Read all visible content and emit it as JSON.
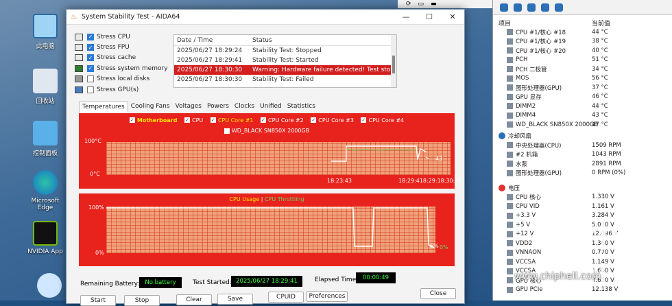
{
  "desktop": {
    "icons": [
      {
        "label": "此电脑"
      },
      {
        "label": "回收站"
      },
      {
        "label": "控制面板"
      },
      {
        "label": "Microsoft Edge"
      },
      {
        "label": "NVIDIA App"
      }
    ]
  },
  "window": {
    "title": "System Stability Test - AIDA64",
    "stress_options": [
      {
        "label": "Stress CPU",
        "checked": true
      },
      {
        "label": "Stress FPU",
        "checked": true
      },
      {
        "label": "Stress cache",
        "checked": true
      },
      {
        "label": "Stress system memory",
        "checked": true
      },
      {
        "label": "Stress local disks",
        "checked": false
      },
      {
        "label": "Stress GPU(s)",
        "checked": false
      }
    ],
    "log": {
      "col_date": "Date / Time",
      "col_status": "Status",
      "rows": [
        {
          "date": "2025/06/27 18:29:24",
          "status": "Stability Test: Stopped"
        },
        {
          "date": "2025/06/27 18:29:41",
          "status": "Stability Test: Started"
        },
        {
          "date": "2025/06/27 18:30:30",
          "status": "Warning: Hardware failure detected! Test stopp..."
        },
        {
          "date": "2025/06/27 18:30:30",
          "status": "Stability Test: Failed"
        }
      ]
    },
    "tabs": [
      "Temperatures",
      "Cooling Fans",
      "Voltages",
      "Powers",
      "Clocks",
      "Unified",
      "Statistics"
    ],
    "temp_graph": {
      "legend": [
        "Motherboard",
        "CPU",
        "CPU Core #1",
        "CPU Core #2",
        "CPU Core #3",
        "CPU Core #4"
      ],
      "legend2": "WD_BLACK SN850X 2000GB",
      "ymax": "100°C",
      "ymin": "0°C",
      "xlabel1": "18:23:43",
      "xlabel2": "18:29:418:29:18:30:30",
      "readout": "43"
    },
    "usage_graph": {
      "legend": "CPU Usage",
      "legend_sep": "|",
      "legend2": "CPU Throttling",
      "ymax": "100%",
      "ymin": "0%",
      "readout1": "6%",
      "readout2": "0%"
    },
    "status": {
      "battery_label": "Remaining Battery:",
      "battery_value": "No battery",
      "started_label": "Test Started:",
      "started_value": "2025/06/27 18:29:41",
      "elapsed_label": "Elapsed Time:",
      "elapsed_value": "00:00:49"
    },
    "buttons": {
      "start": "Start",
      "stop": "Stop",
      "clear": "Clear",
      "save": "Save",
      "cpuid": "CPUID",
      "prefs": "Preferences",
      "close": "Close"
    }
  },
  "sensors": {
    "col_item": "项目",
    "col_value": "当前值",
    "rows": [
      {
        "name": "CPU #1/核心 #18",
        "value": "44 °C"
      },
      {
        "name": "CPU #1/核心 #19",
        "value": "38 °C"
      },
      {
        "name": "CPU #1/核心 #20",
        "value": "40 °C"
      },
      {
        "name": "PCH",
        "value": "51 °C"
      },
      {
        "name": "PCH 二极管",
        "value": "34 °C"
      },
      {
        "name": "MOS",
        "value": "56 °C"
      },
      {
        "name": "图形处理器(GPU)",
        "value": "37 °C"
      },
      {
        "name": "GPU 显存",
        "value": "46 °C"
      },
      {
        "name": "DIMM2",
        "value": "44 °C"
      },
      {
        "name": "DIMM4",
        "value": "43 °C"
      },
      {
        "name": "WD_BLACK SN850X 2000GB",
        "value": "47 °C"
      }
    ],
    "fan_group": "冷却风扇",
    "fans": [
      {
        "name": "中央处理器(CPU)",
        "value": "1509 RPM"
      },
      {
        "name": "#2 机箱",
        "value": "1043 RPM"
      },
      {
        "name": "水泵",
        "value": "2891 RPM"
      },
      {
        "name": "图形处理器(GPU)",
        "value": "0 RPM  (0%)"
      }
    ],
    "volt_group": "电压",
    "volts": [
      {
        "name": "CPU 核心",
        "value": "1.330 V"
      },
      {
        "name": "CPU VID",
        "value": "1.161 V"
      },
      {
        "name": "+3.3 V",
        "value": "3.284 V"
      },
      {
        "name": "+5 V",
        "value": "5.030 V"
      },
      {
        "name": "+12 V",
        "value": "12.096 V"
      },
      {
        "name": "VDD2",
        "value": "1.360 V"
      },
      {
        "name": "VNNAON",
        "value": "0.770 V"
      },
      {
        "name": "VCCSA",
        "value": "1.149 V"
      },
      {
        "name": "VCCSA",
        "value": "1.600 V"
      },
      {
        "name": "GPU 核心",
        "value": "0.650 V"
      },
      {
        "name": "GPU PCIe",
        "value": "12.138 V"
      }
    ]
  },
  "watermark": {
    "logo": "chip hell",
    "url": "www.chiphell.com"
  }
}
